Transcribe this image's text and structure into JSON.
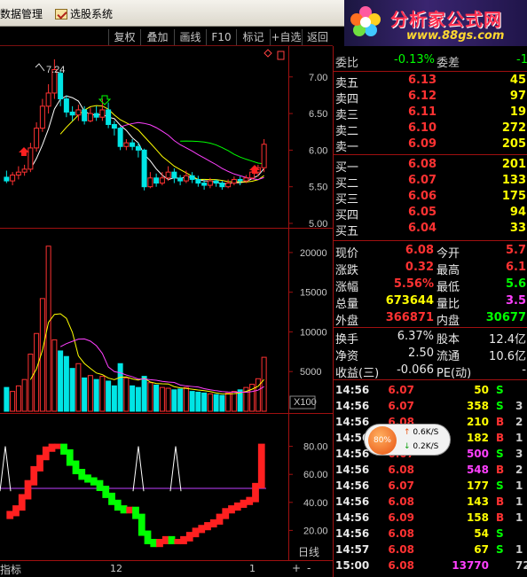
{
  "menu": {
    "items": [
      {
        "label": "数据管理"
      },
      {
        "label": "选股系统"
      }
    ]
  },
  "logo": {
    "title": "分析家公式网",
    "url": "www.88gs.com"
  },
  "toolbar": {
    "buttons": [
      "复权",
      "叠加",
      "画线",
      "F10",
      "标记",
      "+自选",
      "返回"
    ]
  },
  "price_panel": {
    "axis_ticks": [
      "7.00",
      "6.50",
      "6.00",
      "5.50",
      "5.00"
    ],
    "high_label": "7.24"
  },
  "volume_panel": {
    "axis_ticks": [
      "20000",
      "15000",
      "10000",
      "5000"
    ],
    "unit_label": "X100"
  },
  "indicator_panel": {
    "axis_ticks": [
      "80.00",
      "60.00",
      "40.00",
      "20.00"
    ]
  },
  "bottom_bar": {
    "left_label": "指标",
    "date_ticks": [
      "12",
      "1"
    ],
    "period_label": "日线",
    "plus": "+",
    "minus": "-"
  },
  "quotes": {
    "header": {
      "label1": "委比",
      "value1": "-0.13%",
      "label2": "委差",
      "value2": "-1"
    },
    "sells": [
      {
        "label": "卖五",
        "price": "6.13",
        "vol": "45"
      },
      {
        "label": "卖四",
        "price": "6.12",
        "vol": "97"
      },
      {
        "label": "卖三",
        "price": "6.11",
        "vol": "19"
      },
      {
        "label": "卖二",
        "price": "6.10",
        "vol": "272"
      },
      {
        "label": "卖一",
        "price": "6.09",
        "vol": "205"
      }
    ],
    "buys": [
      {
        "label": "买一",
        "price": "6.08",
        "vol": "201"
      },
      {
        "label": "买二",
        "price": "6.07",
        "vol": "133"
      },
      {
        "label": "买三",
        "price": "6.06",
        "vol": "175"
      },
      {
        "label": "买四",
        "price": "6.05",
        "vol": "94"
      },
      {
        "label": "买五",
        "price": "6.04",
        "vol": "33"
      }
    ],
    "stats": [
      {
        "l1": "现价",
        "v1": "6.08",
        "l2": "今开",
        "v2": "5.7"
      },
      {
        "l1": "涨跌",
        "v1": "0.32",
        "l2": "最高",
        "v2": "6.1"
      },
      {
        "l1": "涨幅",
        "v1": "5.56%",
        "l2": "最低",
        "v2": "5.6"
      },
      {
        "l1": "总量",
        "v1": "673644",
        "l2": "量比",
        "v2": "3.5"
      },
      {
        "l1": "外盘",
        "v1": "366871",
        "l2": "内盘",
        "v2": "30677"
      }
    ],
    "stats2": [
      {
        "l1": "换手",
        "v1": "6.37%",
        "l2": "股本",
        "v2": "12.4亿"
      },
      {
        "l1": "净资",
        "v1": "2.50",
        "l2": "流通",
        "v2": "10.6亿"
      },
      {
        "l1": "收益(三)",
        "v1": "-0.066",
        "l2": "PE(动)",
        "v2": "-"
      }
    ],
    "ticks": [
      {
        "time": "14:56",
        "price": "6.07",
        "vol": "50",
        "side": "S",
        "extra": ""
      },
      {
        "time": "14:56",
        "price": "6.07",
        "vol": "358",
        "side": "S",
        "extra": "3"
      },
      {
        "time": "14:56",
        "price": "6.08",
        "vol": "210",
        "side": "B",
        "extra": "2"
      },
      {
        "time": "14:56",
        "price": "6.08",
        "vol": "182",
        "side": "B",
        "extra": "1"
      },
      {
        "time": "14:56",
        "price": "6.07",
        "vol": "500",
        "side": "S",
        "extra": "3"
      },
      {
        "time": "14:56",
        "price": "6.08",
        "vol": "548",
        "side": "B",
        "extra": "2"
      },
      {
        "time": "14:56",
        "price": "6.07",
        "vol": "177",
        "side": "S",
        "extra": "1"
      },
      {
        "time": "14:56",
        "price": "6.08",
        "vol": "143",
        "side": "B",
        "extra": "1"
      },
      {
        "time": "14:56",
        "price": "6.09",
        "vol": "158",
        "side": "B",
        "extra": "1"
      },
      {
        "time": "14:56",
        "price": "6.08",
        "vol": "54",
        "side": "S",
        "extra": ""
      },
      {
        "time": "14:57",
        "price": "6.08",
        "vol": "67",
        "side": "S",
        "extra": "1"
      },
      {
        "time": "15:00",
        "price": "6.08",
        "vol": "13770",
        "side": "",
        "extra": "72"
      }
    ]
  },
  "speed_popup": {
    "percent": "80%",
    "up": "0.6K/S",
    "down": "0.2K/S"
  },
  "colors": {
    "up": "#ff3232",
    "down": "#00e5e5",
    "green": "#00ff00",
    "yellow": "#ffff00",
    "magenta": "#ff40ff",
    "axis": "#a01010"
  },
  "chart_data": {
    "type": "candlestick",
    "candles": [
      [
        5.63,
        5.58,
        5.72,
        5.55
      ],
      [
        5.58,
        5.66,
        5.7,
        5.52
      ],
      [
        5.66,
        5.7,
        5.78,
        5.6
      ],
      [
        5.7,
        5.74,
        5.8,
        5.65
      ],
      [
        5.74,
        6.03,
        6.1,
        5.7
      ],
      [
        6.03,
        6.3,
        6.38,
        5.98
      ],
      [
        6.3,
        6.6,
        6.7,
        6.25
      ],
      [
        6.6,
        6.78,
        6.9,
        6.5
      ],
      [
        6.78,
        7.1,
        7.24,
        6.7
      ],
      [
        7.05,
        6.7,
        7.1,
        6.6
      ],
      [
        6.7,
        6.52,
        6.75,
        6.45
      ],
      [
        6.52,
        6.48,
        6.6,
        6.4
      ],
      [
        6.48,
        6.55,
        6.62,
        6.4
      ],
      [
        6.55,
        6.4,
        6.6,
        6.35
      ],
      [
        6.4,
        6.5,
        6.58,
        6.38
      ],
      [
        6.5,
        6.45,
        6.6,
        6.4
      ],
      [
        6.45,
        6.55,
        6.7,
        6.4
      ],
      [
        6.55,
        6.35,
        6.65,
        6.3
      ],
      [
        6.35,
        6.3,
        6.4,
        6.2
      ],
      [
        6.3,
        6.05,
        6.32,
        6.0
      ],
      [
        6.05,
        6.1,
        6.15,
        6.0
      ],
      [
        6.1,
        6.05,
        6.15,
        6.0
      ],
      [
        6.05,
        6.0,
        6.1,
        5.9
      ],
      [
        6.0,
        5.5,
        6.02,
        5.45
      ],
      [
        5.5,
        5.62,
        5.7,
        5.48
      ],
      [
        5.62,
        5.55,
        5.68,
        5.5
      ],
      [
        5.55,
        5.62,
        5.7,
        5.52
      ],
      [
        5.62,
        5.7,
        5.78,
        5.58
      ],
      [
        5.7,
        5.62,
        5.75,
        5.55
      ],
      [
        5.62,
        5.58,
        5.66,
        5.52
      ],
      [
        5.58,
        5.65,
        5.72,
        5.55
      ],
      [
        5.65,
        5.6,
        5.7,
        5.55
      ],
      [
        5.6,
        5.55,
        5.65,
        5.5
      ],
      [
        5.55,
        5.52,
        5.6,
        5.46
      ],
      [
        5.52,
        5.58,
        5.62,
        5.48
      ],
      [
        5.58,
        5.55,
        5.6,
        5.5
      ],
      [
        5.55,
        5.5,
        5.58,
        5.46
      ],
      [
        5.5,
        5.55,
        5.6,
        5.48
      ],
      [
        5.55,
        5.6,
        5.64,
        5.52
      ],
      [
        5.6,
        5.58,
        5.64,
        5.52
      ],
      [
        5.58,
        5.62,
        5.66,
        5.55
      ],
      [
        5.62,
        5.7,
        5.74,
        5.6
      ],
      [
        5.7,
        5.76,
        5.8,
        5.64
      ],
      [
        5.76,
        6.08,
        6.15,
        5.7
      ]
    ],
    "volume": [
      3000,
      2500,
      3200,
      4000,
      7200,
      9800,
      14200,
      20800,
      9000,
      7600,
      6900,
      5400,
      6000,
      4200,
      4500,
      4000,
      4400,
      3800,
      3200,
      6000,
      4200,
      3200,
      3000,
      4400,
      3600,
      3300,
      3000,
      2900,
      2700,
      2800,
      3000,
      2500,
      2400,
      2300,
      2200,
      2100,
      2000,
      2300,
      2500,
      2700,
      3000,
      3400,
      4100,
      6800
    ],
    "kdj": [
      30,
      32,
      36,
      44,
      54,
      64,
      72,
      78,
      80,
      80,
      76,
      68,
      62,
      58,
      56,
      54,
      50,
      45,
      40,
      36,
      34,
      35,
      30,
      18,
      12,
      10,
      12,
      14,
      12,
      12,
      14,
      17,
      20,
      22,
      24,
      26,
      30,
      34,
      36,
      38,
      40,
      42,
      52,
      80
    ],
    "ylim_price": [
      5.0,
      7.3
    ],
    "ylim_volume": [
      0,
      22000
    ],
    "ylim_kdj": [
      0,
      100
    ]
  }
}
